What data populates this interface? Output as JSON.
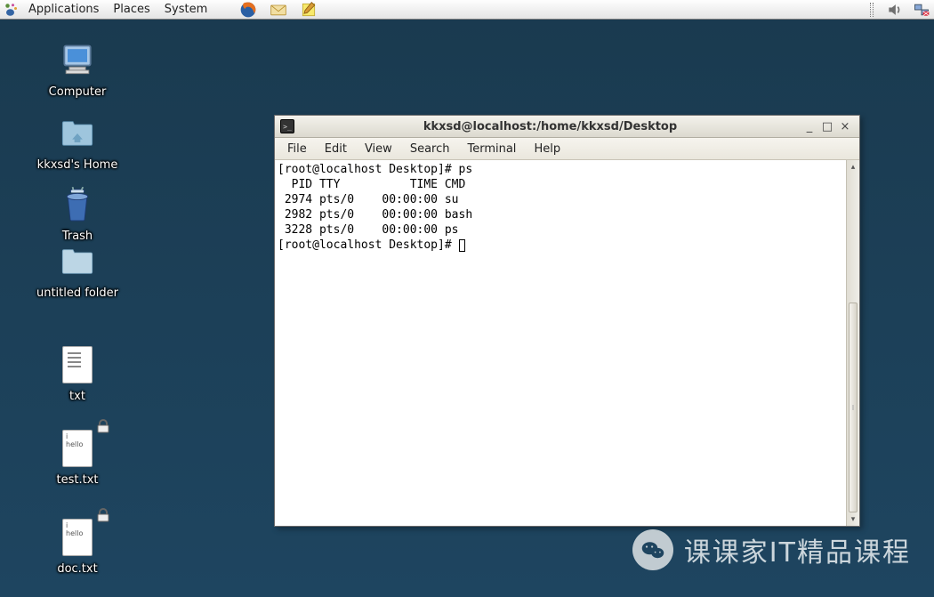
{
  "panel": {
    "applications": "Applications",
    "places": "Places",
    "system": "System"
  },
  "panel_launchers": {
    "firefox": "firefox-icon",
    "email": "email-icon",
    "notes": "notes-icon"
  },
  "tray": {
    "sound": "sound-icon",
    "network": "network-icon"
  },
  "desktop_icons": {
    "computer": "Computer",
    "home": "kkxsd's Home",
    "trash": "Trash",
    "untitled": "untitled folder",
    "txt": "txt",
    "test_txt": "test.txt",
    "doc_txt": "doc.txt",
    "file_preview_line1": "i",
    "file_preview_line2": "hello"
  },
  "terminal": {
    "title": "kkxsd@localhost:/home/kkxsd/Desktop",
    "menu": {
      "file": "File",
      "edit": "Edit",
      "view": "View",
      "search": "Search",
      "terminal": "Terminal",
      "help": "Help"
    },
    "lines": [
      "[root@localhost Desktop]# ps",
      "  PID TTY          TIME CMD",
      " 2974 pts/0    00:00:00 su",
      " 2982 pts/0    00:00:00 bash",
      " 3228 pts/0    00:00:00 ps",
      "[root@localhost Desktop]# "
    ],
    "win_buttons": {
      "min": "_",
      "max": "□",
      "close": "×"
    }
  },
  "watermark": {
    "text": "课课家IT精品课程"
  }
}
